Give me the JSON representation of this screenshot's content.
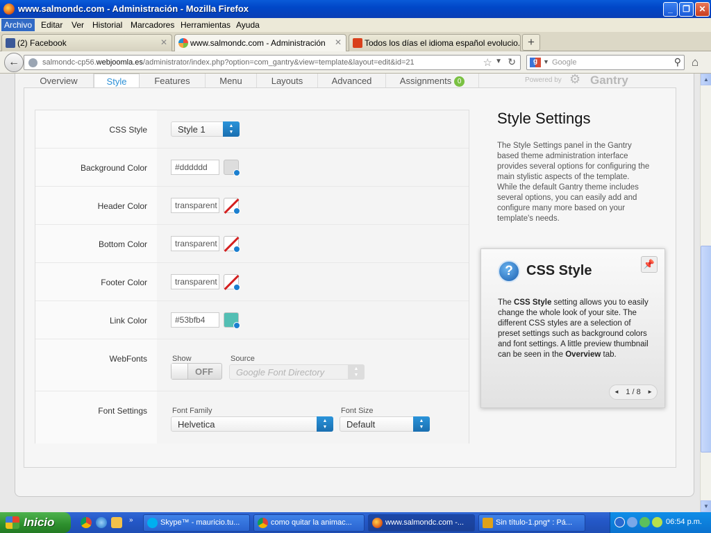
{
  "window": {
    "title": "www.salmondc.com - Administración - Mozilla Firefox"
  },
  "menu": [
    "Archivo",
    "Editar",
    "Ver",
    "Historial",
    "Marcadores",
    "Herramientas",
    "Ayuda"
  ],
  "tabs": [
    {
      "label": "(2) Facebook"
    },
    {
      "label": "www.salmondc.com - Administración"
    },
    {
      "label": "Todos los días el idioma español evolucio..."
    }
  ],
  "nav": {
    "url_pre": "salmondc-cp56.",
    "url_domain": "webjoomla.es",
    "url_post": "/administrator/index.php?option=com_gantry&view=template&layout=edit&id=21",
    "search_placeholder": "Google"
  },
  "gantry": {
    "tabs": [
      "Overview",
      "Style",
      "Features",
      "Menu",
      "Layouts",
      "Advanced",
      "Assignments"
    ],
    "assignments_badge": "0",
    "powered_by": "Powered by",
    "brand": "Gantry"
  },
  "settings": {
    "css_style": {
      "label": "CSS Style",
      "value": "Style 1"
    },
    "background_color": {
      "label": "Background Color",
      "value": "#dddddd"
    },
    "header_color": {
      "label": "Header Color",
      "value": "transparent"
    },
    "bottom_color": {
      "label": "Bottom Color",
      "value": "transparent"
    },
    "footer_color": {
      "label": "Footer Color",
      "value": "transparent"
    },
    "link_color": {
      "label": "Link Color",
      "value": "#53bfb4"
    },
    "webfonts": {
      "label": "WebFonts",
      "show_label": "Show",
      "toggle": "OFF",
      "source_label": "Source",
      "source_value": "Google Font Directory"
    },
    "font_settings": {
      "label": "Font Settings",
      "family_label": "Font Family",
      "family_value": "Helvetica",
      "size_label": "Font Size",
      "size_value": "Default"
    }
  },
  "sidebar": {
    "title": "Style Settings",
    "description": "The Style Settings panel in the Gantry based theme administration interface provides several options for configuring the main stylistic aspects of the template. While the default Gantry theme includes several options, you can easily add and configure many more based on your template's needs."
  },
  "tooltip": {
    "title": "CSS Style",
    "body_pre": "The ",
    "body_bold1": "CSS Style",
    "body_mid": " setting allows you to easily change the whole look of your site. The different CSS styles are a selection of preset settings such as background colors and font settings. A little preview thumbnail can be seen in the ",
    "body_bold2": "Overview",
    "body_post": " tab.",
    "pager": "1 / 8"
  },
  "taskbar": {
    "start": "Inicio",
    "tasks": [
      "Skype™ - mauricio.tu...",
      "como quitar la animac...",
      "www.salmondc.com -...",
      "Sin título-1.png* : Pá..."
    ],
    "clock": "06:54 p.m."
  },
  "colors": {
    "accent": "#2a8fd6",
    "link_color": "#53bfb4",
    "xp_blue": "#0047c8"
  }
}
